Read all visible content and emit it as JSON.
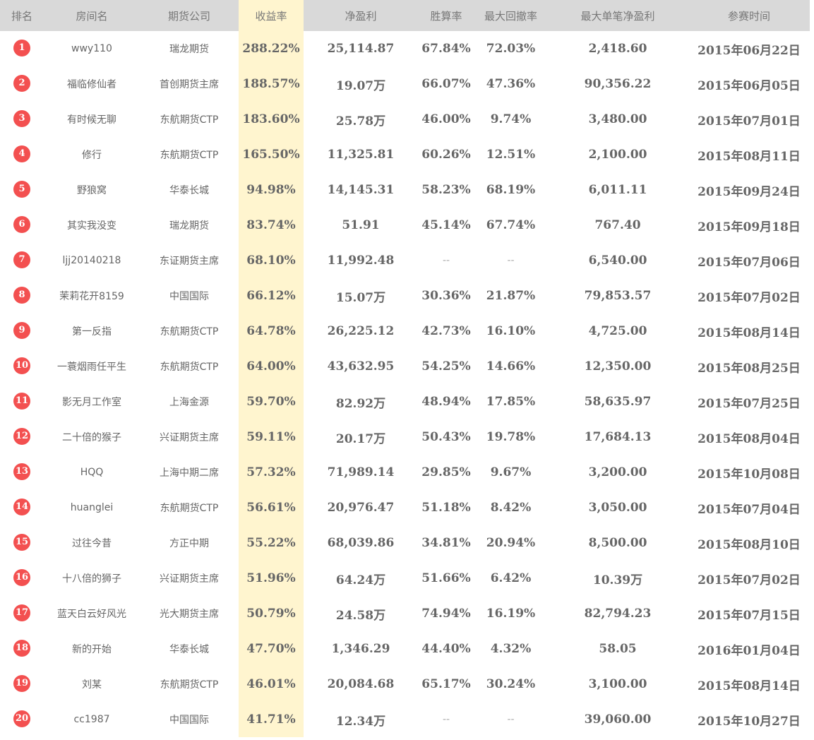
{
  "header": {
    "rank": "排名",
    "name": "房间名",
    "company": "期货公司",
    "return": "收益率",
    "profit": "净盈利",
    "win_rate": "胜算率",
    "drawdown": "最大回撤率",
    "max_profit": "最大单笔净盈利",
    "date": "参赛时间"
  },
  "colors": {
    "header_bg": "#d9d9d9",
    "highlight_col": "#fff5cf",
    "rank_badge": "#f35050"
  },
  "rows": [
    {
      "rank": "1",
      "name": "wwy110",
      "company": "瑞龙期货",
      "return": "288.22%",
      "profit": "25,114.87",
      "win_rate": "67.84%",
      "drawdown": "72.03%",
      "max_profit": "2,418.60",
      "date": "2015年06月22日"
    },
    {
      "rank": "2",
      "name": "福临修仙者",
      "company": "首创期货主席",
      "return": "188.57%",
      "profit": "19.07万",
      "win_rate": "66.07%",
      "drawdown": "47.36%",
      "max_profit": "90,356.22",
      "date": "2015年06月05日"
    },
    {
      "rank": "3",
      "name": "有时候无聊",
      "company": "东航期货CTP",
      "return": "183.60%",
      "profit": "25.78万",
      "win_rate": "46.00%",
      "drawdown": "9.74%",
      "max_profit": "3,480.00",
      "date": "2015年07月01日"
    },
    {
      "rank": "4",
      "name": "修行",
      "company": "东航期货CTP",
      "return": "165.50%",
      "profit": "11,325.81",
      "win_rate": "60.26%",
      "drawdown": "12.51%",
      "max_profit": "2,100.00",
      "date": "2015年08月11日"
    },
    {
      "rank": "5",
      "name": "野狼窝",
      "company": "华泰长城",
      "return": "94.98%",
      "profit": "14,145.31",
      "win_rate": "58.23%",
      "drawdown": "68.19%",
      "max_profit": "6,011.11",
      "date": "2015年09月24日"
    },
    {
      "rank": "6",
      "name": "其实我没变",
      "company": "瑞龙期货",
      "return": "83.74%",
      "profit": "51.91",
      "win_rate": "45.14%",
      "drawdown": "67.74%",
      "max_profit": "767.40",
      "date": "2015年09月18日"
    },
    {
      "rank": "7",
      "name": "ljj20140218",
      "company": "东证期货主席",
      "return": "68.10%",
      "profit": "11,992.48",
      "win_rate": "--",
      "drawdown": "--",
      "max_profit": "6,540.00",
      "date": "2015年07月06日"
    },
    {
      "rank": "8",
      "name": "茉莉花开8159",
      "company": "中国国际",
      "return": "66.12%",
      "profit": "15.07万",
      "win_rate": "30.36%",
      "drawdown": "21.87%",
      "max_profit": "79,853.57",
      "date": "2015年07月02日"
    },
    {
      "rank": "9",
      "name": "第一反指",
      "company": "东航期货CTP",
      "return": "64.78%",
      "profit": "26,225.12",
      "win_rate": "42.73%",
      "drawdown": "16.10%",
      "max_profit": "4,725.00",
      "date": "2015年08月14日"
    },
    {
      "rank": "10",
      "name": "一蓑烟雨任平生",
      "company": "东航期货CTP",
      "return": "64.00%",
      "profit": "43,632.95",
      "win_rate": "54.25%",
      "drawdown": "14.66%",
      "max_profit": "12,350.00",
      "date": "2015年08月25日"
    },
    {
      "rank": "11",
      "name": "影无月工作室",
      "company": "上海金源",
      "return": "59.70%",
      "profit": "82.92万",
      "win_rate": "48.94%",
      "drawdown": "17.85%",
      "max_profit": "58,635.97",
      "date": "2015年07月25日"
    },
    {
      "rank": "12",
      "name": "二十倍的猴子",
      "company": "兴证期货主席",
      "return": "59.11%",
      "profit": "20.17万",
      "win_rate": "50.43%",
      "drawdown": "19.78%",
      "max_profit": "17,684.13",
      "date": "2015年08月04日"
    },
    {
      "rank": "13",
      "name": "HQQ",
      "company": "上海中期二席",
      "return": "57.32%",
      "profit": "71,989.14",
      "win_rate": "29.85%",
      "drawdown": "9.67%",
      "max_profit": "3,200.00",
      "date": "2015年10月08日"
    },
    {
      "rank": "14",
      "name": "huanglei",
      "company": "东航期货CTP",
      "return": "56.61%",
      "profit": "20,976.47",
      "win_rate": "51.18%",
      "drawdown": "8.42%",
      "max_profit": "3,050.00",
      "date": "2015年07月04日"
    },
    {
      "rank": "15",
      "name": "过往今昔",
      "company": "方正中期",
      "return": "55.22%",
      "profit": "68,039.86",
      "win_rate": "34.81%",
      "drawdown": "20.94%",
      "max_profit": "8,500.00",
      "date": "2015年08月10日"
    },
    {
      "rank": "16",
      "name": "十八倍的狮子",
      "company": "兴证期货主席",
      "return": "51.96%",
      "profit": "64.24万",
      "win_rate": "51.66%",
      "drawdown": "6.42%",
      "max_profit": "10.39万",
      "date": "2015年07月02日"
    },
    {
      "rank": "17",
      "name": "蓝天白云好风光",
      "company": "光大期货主席",
      "return": "50.79%",
      "profit": "24.58万",
      "win_rate": "74.94%",
      "drawdown": "16.19%",
      "max_profit": "82,794.23",
      "date": "2015年07月15日"
    },
    {
      "rank": "18",
      "name": "新的开始",
      "company": "华泰长城",
      "return": "47.70%",
      "profit": "1,346.29",
      "win_rate": "44.40%",
      "drawdown": "4.32%",
      "max_profit": "58.05",
      "date": "2016年01月04日"
    },
    {
      "rank": "19",
      "name": "刘某",
      "company": "东航期货CTP",
      "return": "46.01%",
      "profit": "20,084.68",
      "win_rate": "65.17%",
      "drawdown": "30.24%",
      "max_profit": "3,100.00",
      "date": "2015年08月14日"
    },
    {
      "rank": "20",
      "name": "cc1987",
      "company": "中国国际",
      "return": "41.71%",
      "profit": "12.34万",
      "win_rate": "--",
      "drawdown": "--",
      "max_profit": "39,060.00",
      "date": "2015年10月27日"
    }
  ]
}
